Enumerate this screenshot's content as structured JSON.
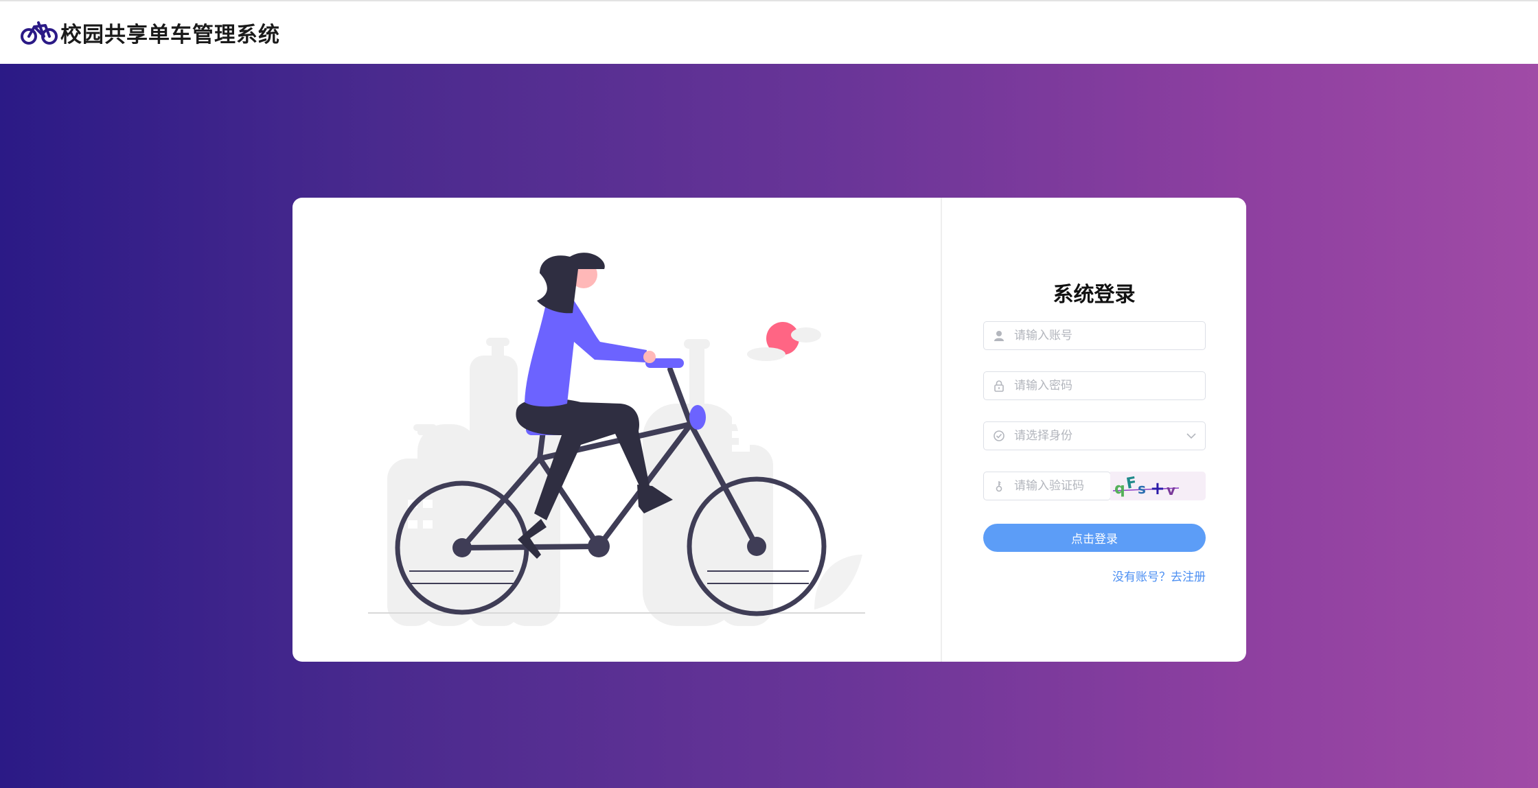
{
  "header": {
    "title": "校园共享单车管理系统",
    "logo_icon": "bicycle-icon",
    "brand_color": "#2b1a86"
  },
  "login": {
    "title": "系统登录",
    "account_placeholder": "请输入账号",
    "password_placeholder": "请输入密码",
    "role_placeholder": "请选择身份",
    "captcha_placeholder": "请输入验证码",
    "captcha_text": "qFs+v",
    "submit_label": "点击登录",
    "register_link": "没有账号？去注册",
    "button_color": "#5c9df7"
  },
  "illustration": {
    "subject": "woman-riding-bicycle",
    "accent_color": "#6c63ff"
  }
}
